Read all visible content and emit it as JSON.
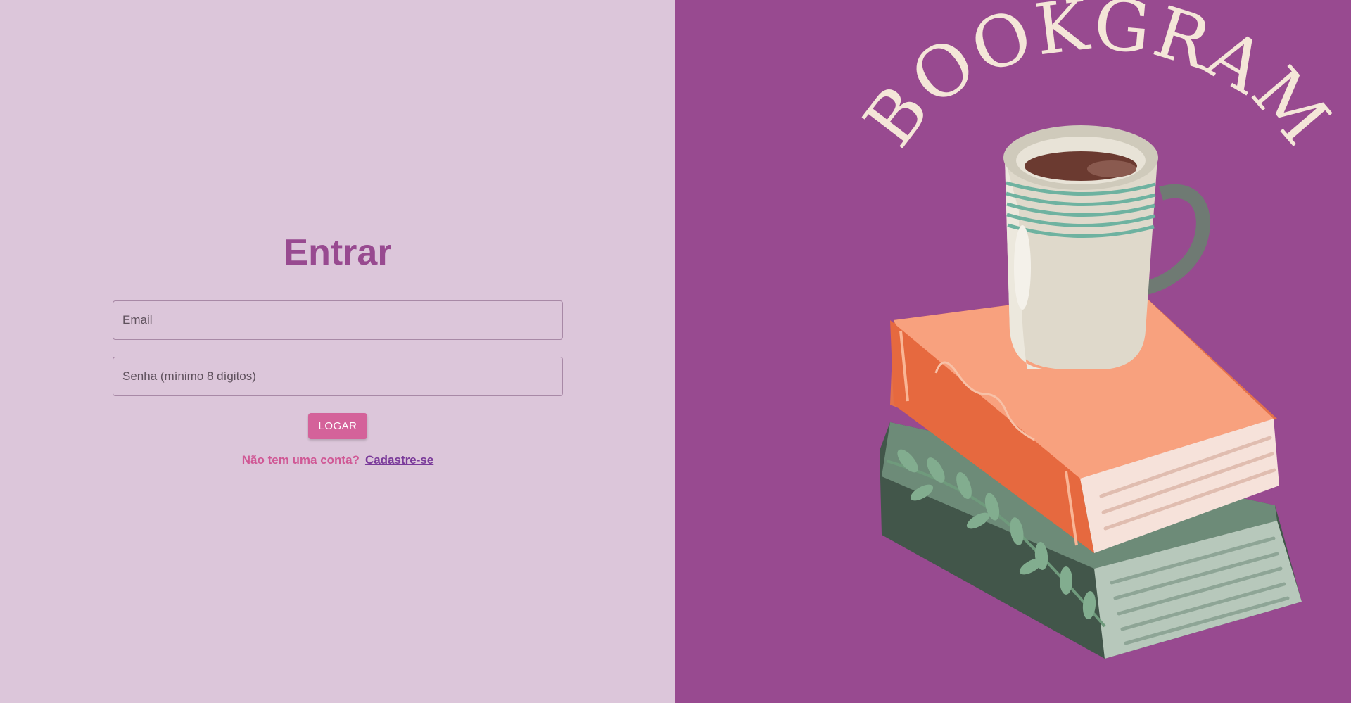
{
  "login": {
    "title": "Entrar",
    "email_placeholder": "Email",
    "password_placeholder": "Senha (mínimo 8 dígitos)",
    "submit_label": "LOGAR",
    "signup_prompt": "Não tem uma conta?",
    "signup_link": "Cadastre-se"
  },
  "brand": {
    "logo_text": "BOOKGRAM"
  },
  "colors": {
    "left_background": "#dcc6da",
    "right_background": "#984a90",
    "accent": "#d4629a",
    "title": "#984a90"
  },
  "icons": [
    "coffee-mug-icon",
    "book-stack-icon"
  ]
}
